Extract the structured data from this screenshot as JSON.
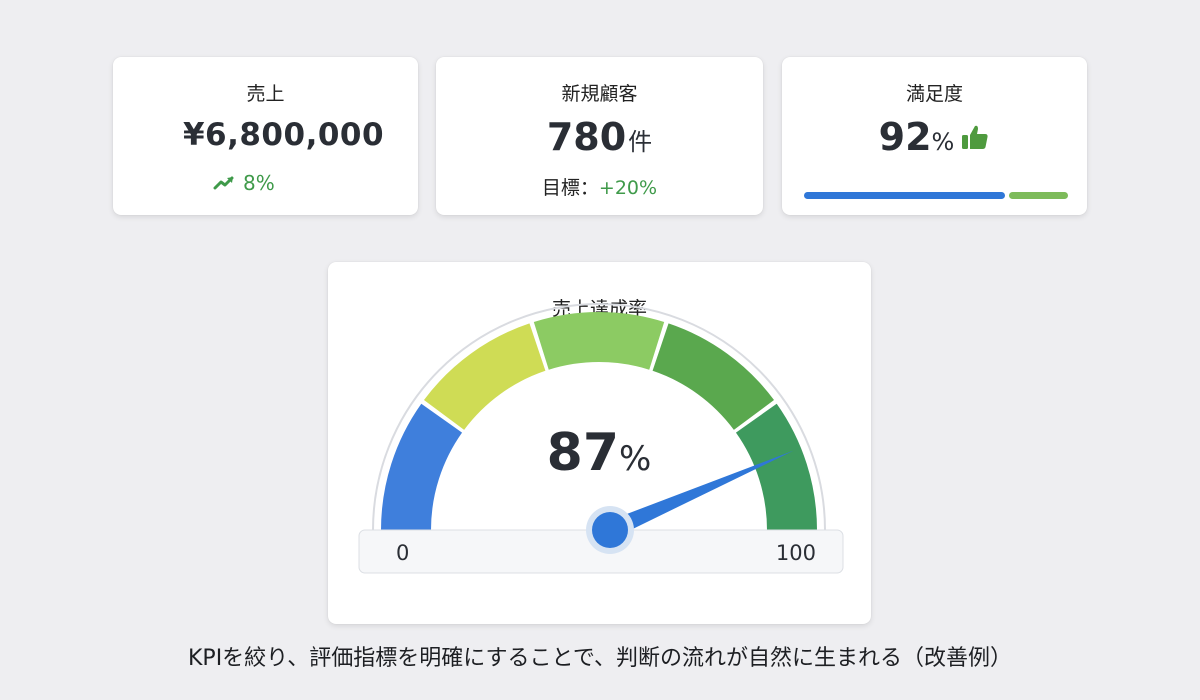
{
  "cards": {
    "sales": {
      "title": "売上",
      "value": "¥6,800,000",
      "trend": "8%"
    },
    "customers": {
      "title": "新規顧客",
      "value": "780",
      "unit": "件",
      "target_label": "目標：",
      "target_value": "+20%"
    },
    "satisfaction": {
      "title": "満足度",
      "value": "92",
      "unit": "%",
      "progress": 0.76
    }
  },
  "gauge": {
    "title": "売上達成率",
    "value": 87,
    "value_label": "87",
    "unit": "%",
    "min_label": "0",
    "max_label": "100"
  },
  "caption": "KPIを絞り、評価指標を明確にすることで、判断の流れが自然に生まれる（改善例）",
  "colors": {
    "accent_blue": "#2f77d8",
    "positive_green": "#3f9a4a",
    "gauge_segments": [
      "#3f7fdc",
      "#cfdc55",
      "#8ccb63",
      "#5aa84e",
      "#3e9a5e"
    ]
  }
}
